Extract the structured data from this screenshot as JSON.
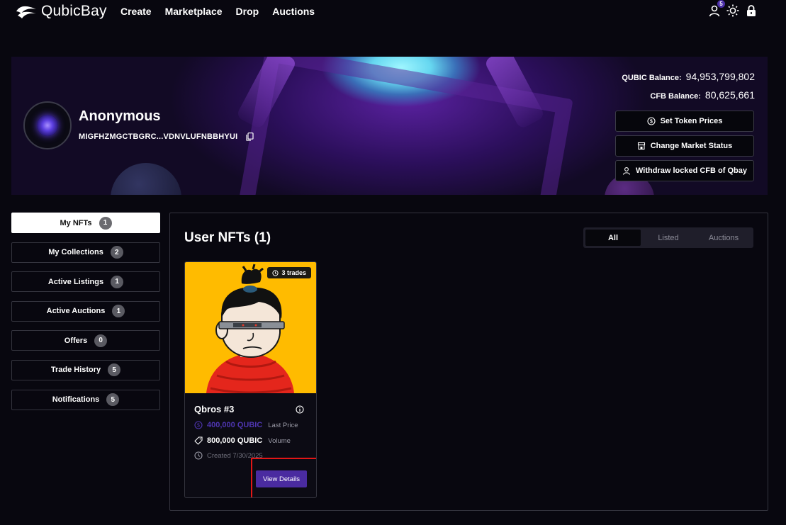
{
  "nav": {
    "brand": "QubicBay",
    "links": [
      "Create",
      "Marketplace",
      "Drop",
      "Auctions"
    ],
    "notification_count": "5",
    "icons": [
      "user-icon",
      "sun-icon",
      "lock-icon"
    ]
  },
  "profile": {
    "name": "Anonymous",
    "address": "MIGFHZMGCTBGRC...VDNVLUFNBBHYUI",
    "qubic_balance_label": "QUBIC Balance:",
    "qubic_balance": "94,953,799,802",
    "cfb_balance_label": "CFB Balance:",
    "cfb_balance": "80,625,661",
    "buttons": {
      "set_token_prices": "Set Token Prices",
      "change_market_status": "Change Market Status",
      "withdraw": "Withdraw locked CFB of Qbay"
    }
  },
  "sidebar": {
    "items": [
      {
        "label": "My NFTs",
        "count": "1"
      },
      {
        "label": "My Collections",
        "count": "2"
      },
      {
        "label": "Active Listings",
        "count": "1"
      },
      {
        "label": "Active Auctions",
        "count": "1"
      },
      {
        "label": "Offers",
        "count": "0"
      },
      {
        "label": "Trade History",
        "count": "5"
      },
      {
        "label": "Notifications",
        "count": "5"
      }
    ]
  },
  "main": {
    "title": "User NFTs (1)",
    "tabs": [
      "All",
      "Listed",
      "Auctions"
    ],
    "selected_tab": "All"
  },
  "nft": {
    "trades": "3 trades",
    "name": "Qbros #3",
    "last_price": "400,000 QUBIC",
    "last_price_label": "Last Price",
    "volume": "800,000 QUBIC",
    "volume_label": "Volume",
    "created": "Created 7/30/2025",
    "view_button": "View Details"
  },
  "colors": {
    "accent": "#4a2ba0",
    "highlight": "#e21616",
    "nft_background": "#ffbb00"
  }
}
